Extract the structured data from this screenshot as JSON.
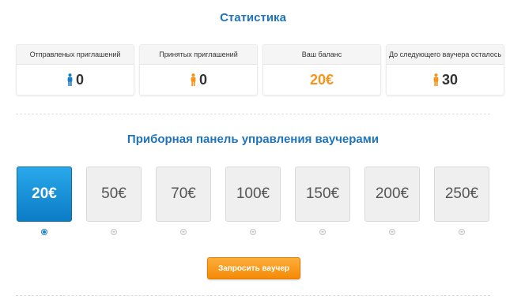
{
  "stats": {
    "title": "Статистика",
    "cards": [
      {
        "label": "Отправленых приглашений",
        "value": "0",
        "icon": "person-blue-icon",
        "icon_color": "#1b7dc4"
      },
      {
        "label": "Принятых приглашений",
        "value": "0",
        "icon": "person-orange-icon",
        "icon_color": "#f7941d"
      },
      {
        "label": "Ваш баланс",
        "value": "20€"
      },
      {
        "label": "До следующего ваучера осталось",
        "value": "30",
        "icon": "person-orange-icon",
        "icon_color": "#f7941d"
      }
    ]
  },
  "vouchers": {
    "title": "Приборная панель управления ваучерами",
    "options": [
      "20€",
      "50€",
      "70€",
      "100€",
      "150€",
      "200€",
      "250€"
    ],
    "selected_index": 0
  },
  "request_button": {
    "label": "Запросить ваучер"
  },
  "colors": {
    "accent_blue": "#1e73be",
    "orange": "#f7941d",
    "selected_voucher": "#1a94dc"
  }
}
